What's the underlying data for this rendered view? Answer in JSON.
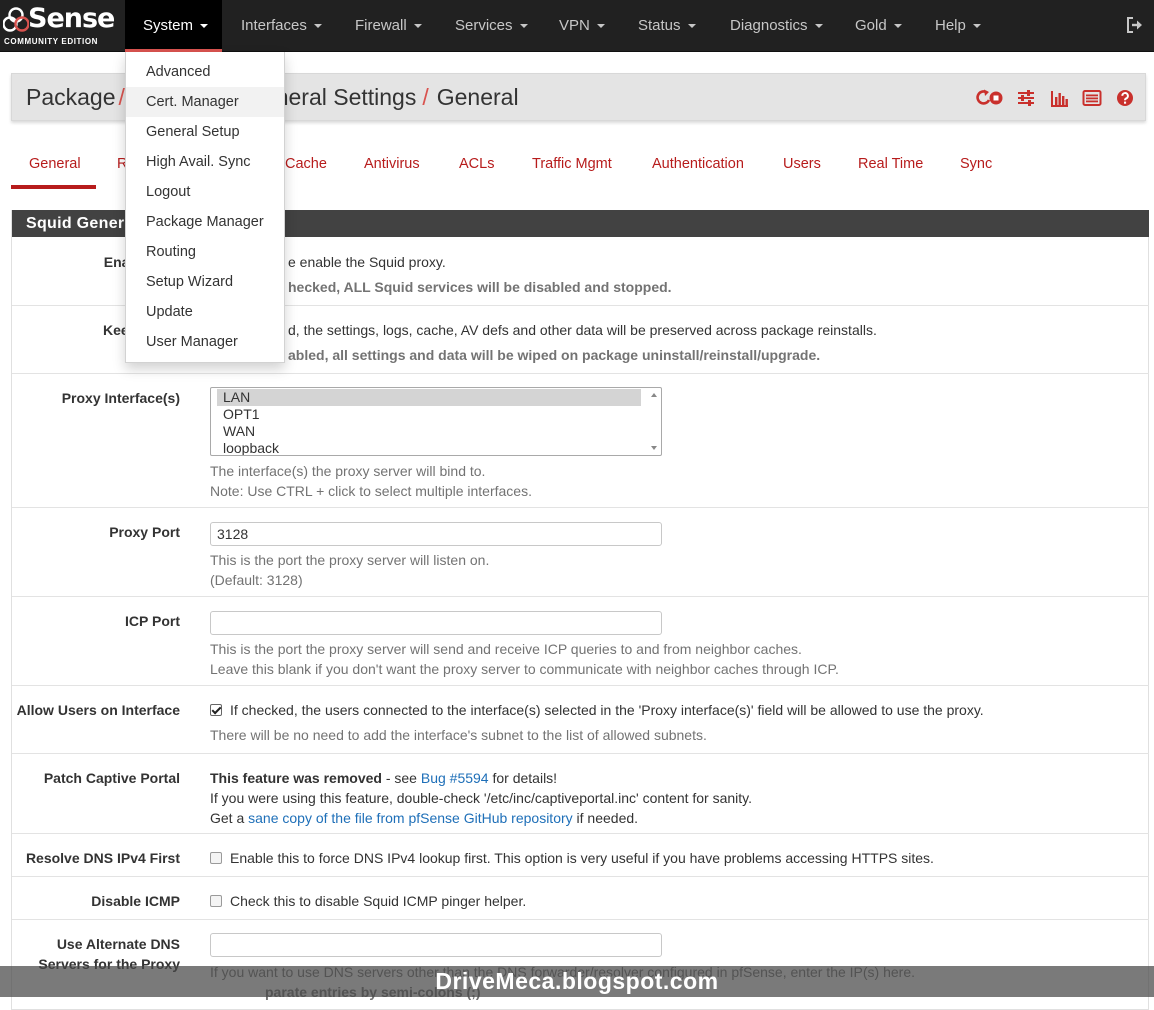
{
  "brand": {
    "name": "Sense",
    "subtitle": "COMMUNITY EDITION"
  },
  "nav": {
    "items": [
      {
        "label": "System",
        "active": true
      },
      {
        "label": "Interfaces"
      },
      {
        "label": "Firewall"
      },
      {
        "label": "Services"
      },
      {
        "label": "VPN"
      },
      {
        "label": "Status"
      },
      {
        "label": "Diagnostics"
      },
      {
        "label": "Gold"
      },
      {
        "label": "Help"
      }
    ]
  },
  "system_menu": {
    "items": [
      "Advanced",
      "Cert. Manager",
      "General Setup",
      "High Avail. Sync",
      "Logout",
      "Package Manager",
      "Routing",
      "Setup Wizard",
      "Update",
      "User Manager"
    ]
  },
  "breadcrumb": {
    "part1": "Package",
    "part2": "eneral Settings",
    "part3": "General",
    "separator": "/"
  },
  "tabs": [
    "General",
    "R",
    "Cache",
    "Antivirus",
    "ACLs",
    "Traffic Mgmt",
    "Authentication",
    "Users",
    "Real Time",
    "Sync"
  ],
  "panel": {
    "heading": "Squid Gener",
    "enable": {
      "label": "Enable Squ",
      "help1": "e enable the Squid proxy.",
      "help2": "hecked, ALL Squid services will be disabled and stopped."
    },
    "keep": {
      "label": "Keep Settin",
      "help1": "d, the settings, logs, cache, AV defs and other data will be preserved across package reinstalls.",
      "help2": "abled, all settings and data will be wiped on package uninstall/reinstall/upgrade."
    },
    "proxy_interfaces": {
      "label": "Proxy Interface(s)",
      "options": [
        "LAN",
        "OPT1",
        "WAN",
        "loopback"
      ],
      "selected": "LAN",
      "help1": "The interface(s) the proxy server will bind to.",
      "help2": "Note: Use CTRL + click to select multiple interfaces."
    },
    "proxy_port": {
      "label": "Proxy Port",
      "value": "3128",
      "help1": "This is the port the proxy server will listen on.",
      "help2": "(Default: 3128)"
    },
    "icp_port": {
      "label": "ICP Port",
      "value": "",
      "help1": "This is the port the proxy server will send and receive ICP queries to and from neighbor caches.",
      "help2": "Leave this blank if you don't want the proxy server to communicate with neighbor caches through ICP."
    },
    "allow_users": {
      "label": "Allow Users on Interface",
      "checked": true,
      "text": "If checked, the users connected to the interface(s) selected in the 'Proxy interface(s)' field will be allowed to use the proxy.",
      "help": "There will be no need to add the interface's subnet to the list of allowed subnets."
    },
    "patch_captive": {
      "label": "Patch Captive Portal",
      "strong": "This feature was removed",
      "see": " - see ",
      "bug_link": "Bug #5594",
      "for_details": " for details!",
      "line2": "If you were using this feature, double-check '/etc/inc/captiveportal.inc' content for sanity.",
      "line3_pre": "Get a ",
      "line3_link": "sane copy of the file from pfSense GitHub repository",
      "line3_post": " if needed."
    },
    "resolve_dns": {
      "label": "Resolve DNS IPv4 First",
      "checked": false,
      "text": "Enable this to force DNS IPv4 lookup first. This option is very useful if you have problems accessing HTTPS sites."
    },
    "disable_icmp": {
      "label": "Disable ICMP",
      "checked": false,
      "text": "Check this to disable Squid ICMP pinger helper."
    },
    "alt_dns": {
      "label_line1": "Use Alternate DNS",
      "label_line2": "Servers for the Proxy",
      "value": "",
      "help1": "If you want to use DNS servers other than the DNS forwarder/resolver configured in pfSense, enter the IP(s) here.",
      "help2": "parate entries by semi-colons (;)"
    }
  },
  "watermark": "DriveMeca.blogspot.com",
  "colors": {
    "accent": "#b71c1c",
    "navbar": "#212121",
    "heading": "#424242",
    "link": "#1e6fb8"
  }
}
